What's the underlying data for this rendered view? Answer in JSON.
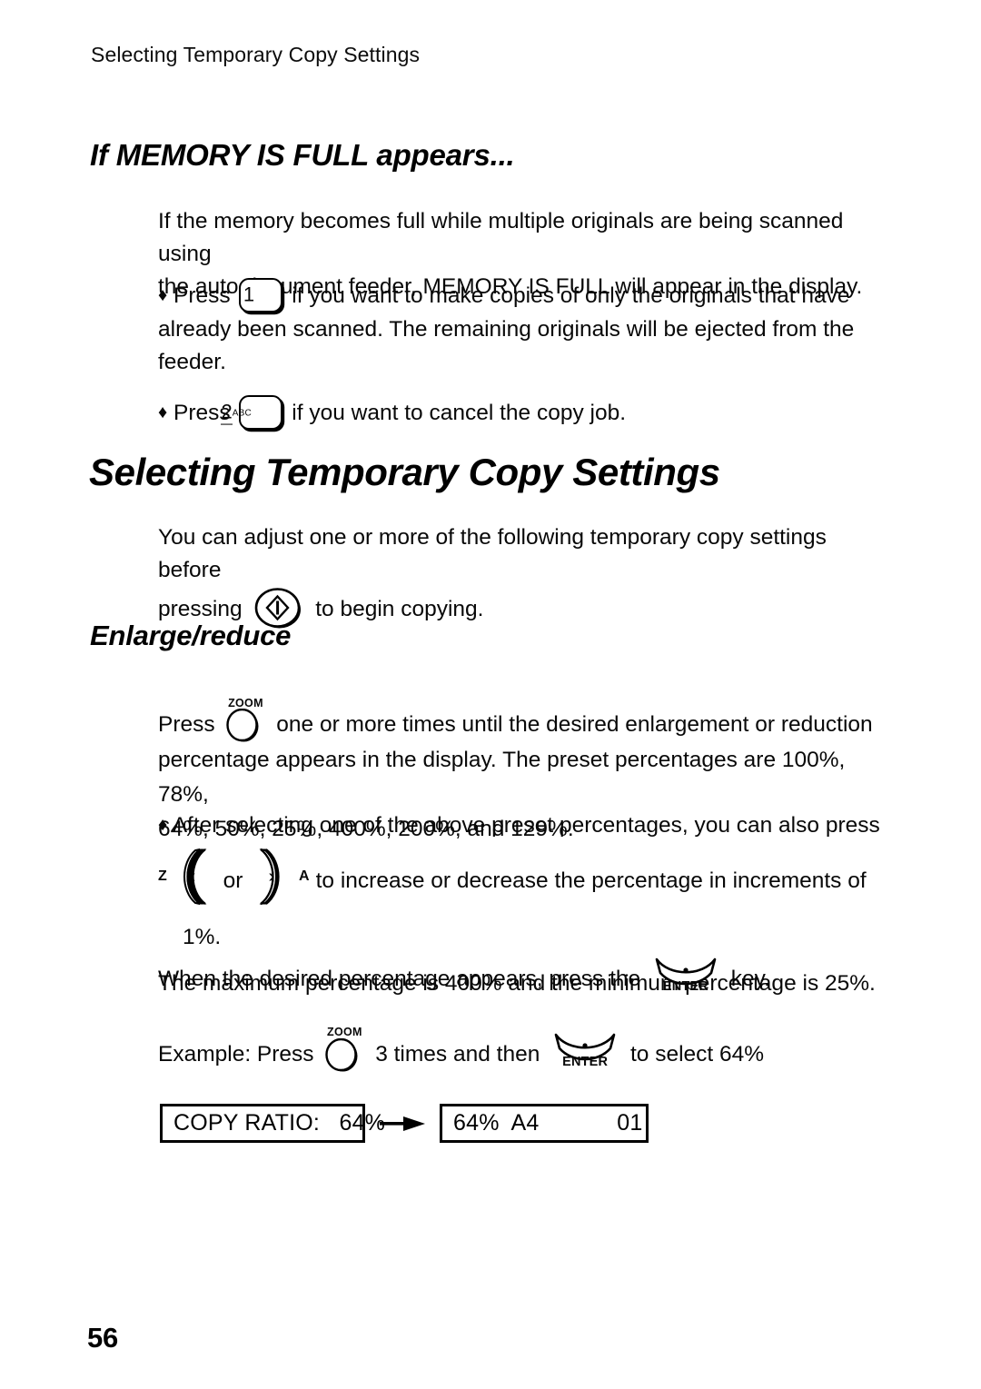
{
  "page": {
    "running_head": "Selecting Temporary Copy Settings",
    "folio": "56"
  },
  "section_memory": {
    "heading": "If MEMORY IS FULL appears...",
    "intro": {
      "line1": "If the memory becomes full while multiple originals are being scanned using",
      "line2": "the auto document feeder, MEMORY IS FULL will appear in the display."
    },
    "bullets": [
      {
        "mark": "♦",
        "before_key": "Press",
        "key": {
          "name": "key-1",
          "digit": "1",
          "sup": ""
        },
        "after_key": "if you want to make copies of only the originals that have",
        "line2": "already been scanned. The remaining originals will be ejected from the",
        "line3": "feeder."
      },
      {
        "mark": "♦",
        "before_key": "Press",
        "key": {
          "name": "key-2-abc",
          "digit": "2",
          "sup": "ABC"
        },
        "after_key": "if you want to cancel the copy job."
      }
    ]
  },
  "section_temporary": {
    "heading": "Selecting Temporary Copy Settings",
    "intro": {
      "line1": "You can adjust one or more of the following temporary copy settings before",
      "line2_before": "pressing",
      "start_key_label": "start-key",
      "line2_after": "to begin copying."
    }
  },
  "section_enlarge": {
    "heading": "Enlarge/reduce",
    "para1": {
      "before_key": "Press",
      "zoom_key_label": "ZOOM",
      "after_key": "one or more times until the desired enlargement or reduction",
      "line2": "percentage appears in the display. The preset percentages are 100%, 78%,",
      "line3": "64%, 50%, 25%, 400%, 200%, and 129%."
    },
    "preset_percentages": [
      "100%",
      "78%",
      "64%",
      "50%",
      "25%",
      "400%",
      "200%",
      "129%"
    ],
    "bullet": {
      "mark": "♦",
      "line1": "After selecting one of the above preset percentages, you can also press",
      "left_key_cap": "Z",
      "left_key_glyph": "‹",
      "conjunction": "or",
      "right_key_glyph": "›",
      "right_key_cap": "A",
      "line2_after": "to increase or decrease the percentage in increments of 1%.",
      "line3": "The maximum  percentage is 400% and the minimum percentage is 25%."
    },
    "enter_line": {
      "before_key": "When the desired percentage appears, press the",
      "enter_key_label": "ENTER",
      "after_key": "key."
    },
    "example_line": {
      "before_zoom": "Example: Press",
      "zoom_key_label": "ZOOM",
      "middle": "3 times and then",
      "enter_key_label": "ENTER",
      "after_enter": "to select 64%"
    },
    "displays": {
      "left": "COPY RATIO:   64%",
      "right": "64%  A4            01",
      "arrow": "▶"
    }
  },
  "colors": {
    "ink": "#000000",
    "paper": "#ffffff"
  }
}
